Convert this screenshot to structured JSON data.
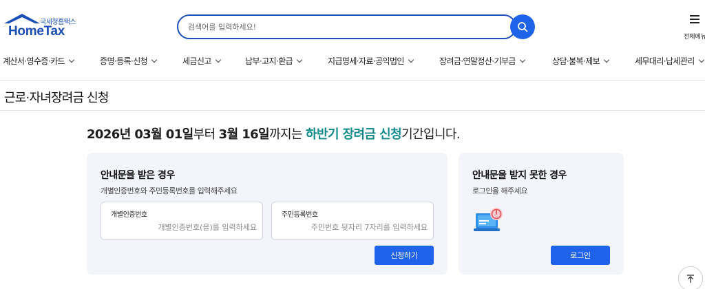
{
  "logo": {
    "subtitle": "국세청홈택스",
    "title": "HomeTax"
  },
  "search": {
    "placeholder": "검색어를 입력하세요!"
  },
  "menu_all_label": "전체메뉴",
  "nav": [
    {
      "label": "계산서·영수증·카드"
    },
    {
      "label": "증명·등록·신청"
    },
    {
      "label": "세금신고"
    },
    {
      "label": "납부·고지·환급"
    },
    {
      "label": "지급명세·자료·공익법인"
    },
    {
      "label": "장려금·연말정산·기부금"
    },
    {
      "label": "상담·불복·제보"
    },
    {
      "label": "세무대리·납세관리"
    }
  ],
  "page_title": "근로·자녀장려금 신청",
  "banner": {
    "date_start": "2026년 03월 01일",
    "text_from": "부터 ",
    "date_end": "3월 16일",
    "text_until": "까지는 ",
    "highlight": "하반기 장려금 신청",
    "text_tail": "기간입니다."
  },
  "card_left": {
    "title": "안내문을 받은 경우",
    "desc": "개별인증번호와 주민등록번호를 입력해주세요",
    "field1_label": "개별인증번호",
    "field1_placeholder": "개별인증번호(을)를 입력하세요",
    "field2_label": "주민등록번호",
    "field2_placeholder": "주민번호 뒷자리 7자리를 입력하세요",
    "button": "신청하기"
  },
  "card_right": {
    "title": "안내문을 받지 못한 경우",
    "desc": "로그인을 해주세요",
    "button": "로그인"
  },
  "colors": {
    "brand": "#1b4fb5",
    "button": "#1e63e9",
    "highlight": "#128a8a",
    "card_bg": "#f3f5fa"
  },
  "icons": [
    "house-roof-icon",
    "search-icon",
    "hamburger-menu-icon",
    "chevron-down-icon",
    "laptop-power-icon",
    "arrow-up-icon"
  ]
}
